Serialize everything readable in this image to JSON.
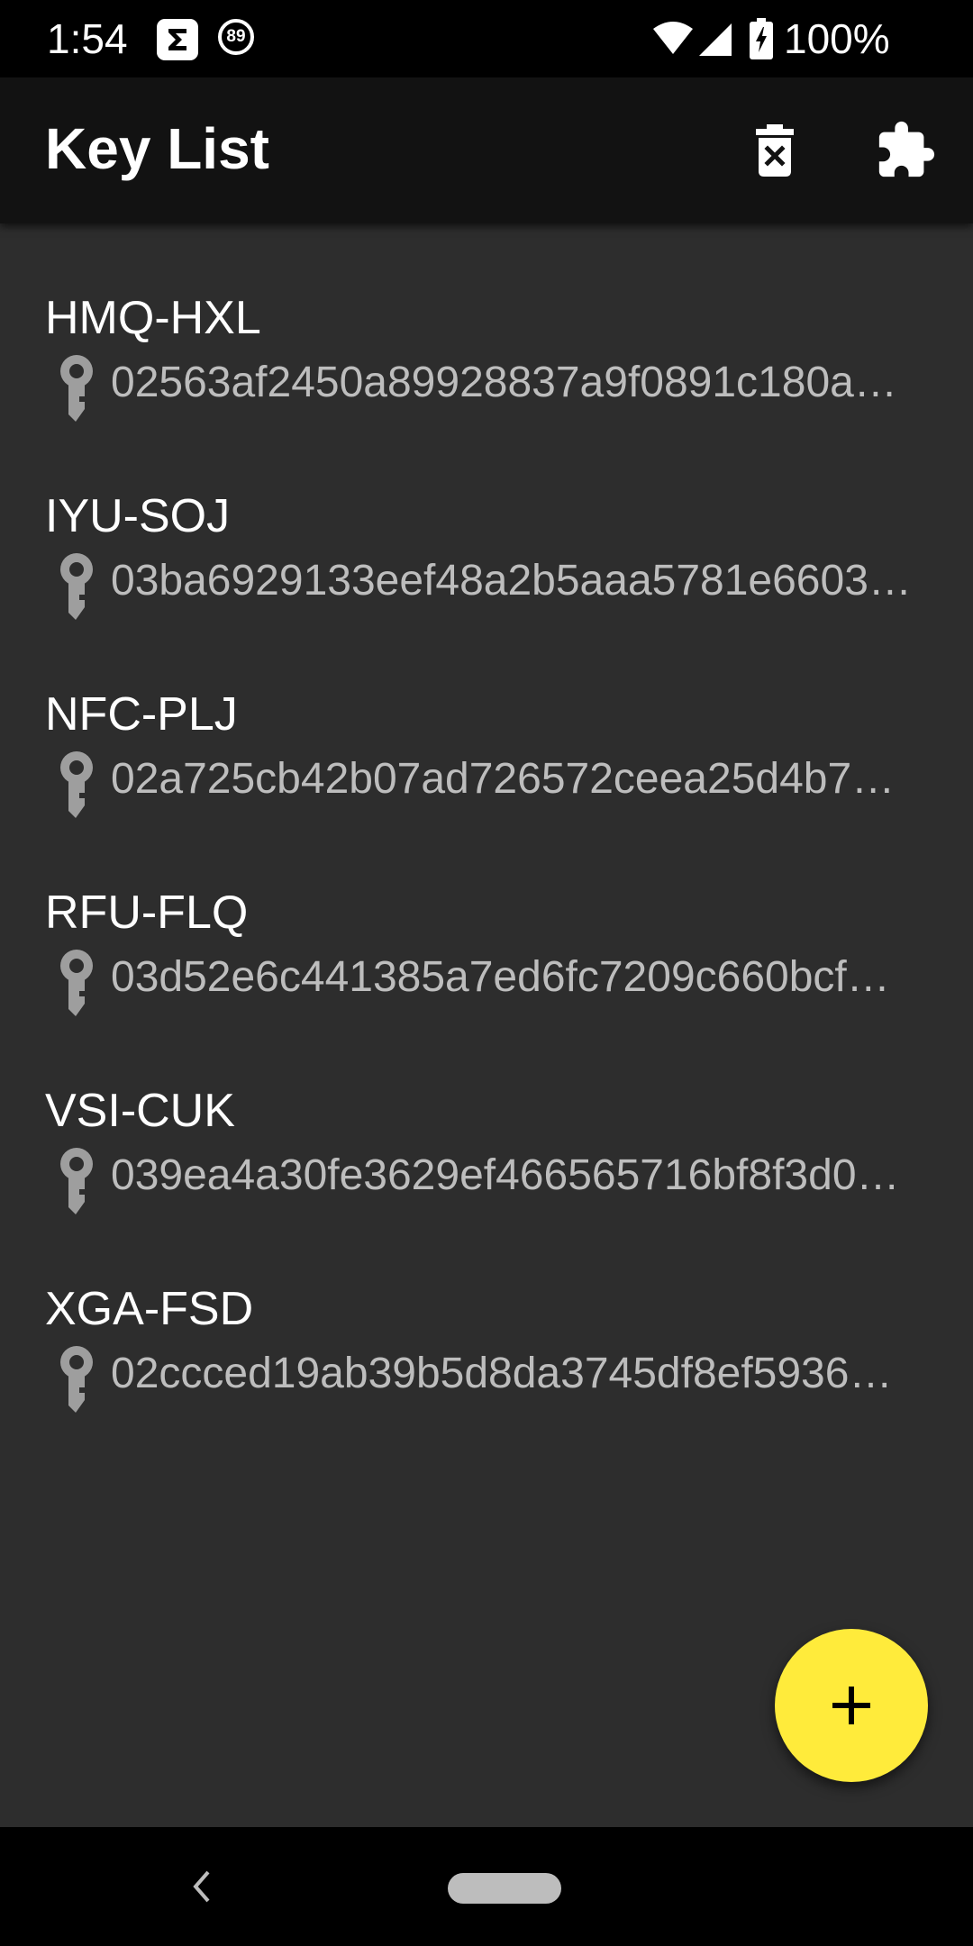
{
  "status_bar": {
    "time": "1:54",
    "notification_badge": "89",
    "battery_percent": "100%"
  },
  "app_bar": {
    "title": "Key List",
    "actions": [
      {
        "icon": "delete-forever-icon"
      },
      {
        "icon": "extension-icon"
      }
    ]
  },
  "keys": [
    {
      "name": "HMQ-HXL",
      "hash": "02563af2450a89928837a9f0891c180a…"
    },
    {
      "name": "IYU-SOJ",
      "hash": "03ba6929133eef48a2b5aaa5781e6603…"
    },
    {
      "name": "NFC-PLJ",
      "hash": "02a725cb42b07ad726572ceea25d4b7…"
    },
    {
      "name": "RFU-FLQ",
      "hash": "03d52e6c441385a7ed6fc7209c660bcf…"
    },
    {
      "name": "VSI-CUK",
      "hash": "039ea4a30fe3629ef466565716bf8f3d0…"
    },
    {
      "name": "XGA-FSD",
      "hash": "02ccced19ab39b5d8da3745df8ef5936…"
    }
  ],
  "fab": {
    "icon": "plus-icon"
  },
  "nav_bar": {
    "back_icon": "back-chevron-icon",
    "home_icon": "home-pill-icon"
  },
  "colors": {
    "app_bar_background": "#121212",
    "list_background": "#2d2d2d",
    "fab_accent": "#ffeb3b",
    "secondary_text": "#bdbdbd"
  }
}
